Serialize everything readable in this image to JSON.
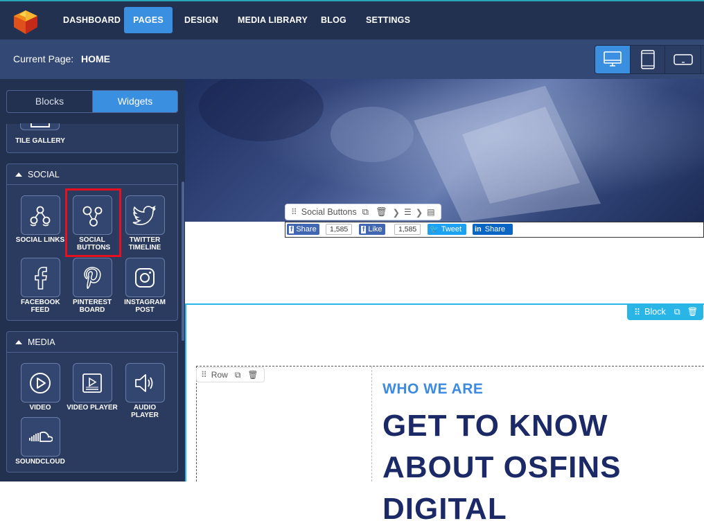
{
  "nav": {
    "items": [
      {
        "label": "DASHBOARD"
      },
      {
        "label": "PAGES"
      },
      {
        "label": "DESIGN"
      },
      {
        "label": "MEDIA LIBRARY"
      },
      {
        "label": "BLOG"
      },
      {
        "label": "SETTINGS"
      }
    ],
    "active": "PAGES"
  },
  "subbar": {
    "current_label": "Current Page:",
    "current_value": "HOME",
    "devices": [
      "desktop-icon",
      "tablet-icon",
      "mobile-landscape-icon"
    ]
  },
  "sidebar": {
    "tabs": [
      {
        "label": "Blocks"
      },
      {
        "label": "Widgets"
      }
    ],
    "active_tab": "Widgets",
    "gallery_partial": {
      "label": "TILE GALLERY"
    },
    "social": {
      "title": "SOCIAL",
      "widgets": [
        {
          "label": "SOCIAL LINKS",
          "icon": "social-links-icon"
        },
        {
          "label": "SOCIAL BUTTONS",
          "icon": "social-buttons-icon"
        },
        {
          "label": "TWITTER TIMELINE",
          "icon": "twitter-icon"
        },
        {
          "label": "FACEBOOK FEED",
          "icon": "facebook-icon"
        },
        {
          "label": "PINTEREST BOARD",
          "icon": "pinterest-icon"
        },
        {
          "label": "INSTAGRAM POST",
          "icon": "instagram-icon"
        }
      ]
    },
    "media": {
      "title": "MEDIA",
      "widgets": [
        {
          "label": "VIDEO",
          "icon": "video-icon"
        },
        {
          "label": "VIDEO PLAYER",
          "icon": "video-player-icon"
        },
        {
          "label": "AUDIO PLAYER",
          "icon": "audio-icon"
        },
        {
          "label": "SOUNDCLOUD",
          "icon": "soundcloud-icon"
        }
      ]
    }
  },
  "editor": {
    "social_toolbar": {
      "label": "Social Buttons"
    },
    "social_buttons": {
      "fb_share": "Share",
      "fb_share_count": "1,585",
      "fb_like": "Like",
      "fb_like_count": "1,585",
      "tweet": "Tweet",
      "linkedin_share": "Share"
    },
    "block_tag": {
      "label": "Block"
    },
    "row_tag": {
      "label": "Row"
    },
    "kicker": "WHO WE ARE",
    "headline": "GET TO KNOW ABOUT OSFINS DIGITAL"
  },
  "colors": {
    "topbar": "#233151",
    "subbar": "#344876",
    "accent": "#3b8fe0",
    "block_border": "#29b6e6",
    "highlight": "#e8101e",
    "headline": "#1b2a66",
    "kicker": "#3d8be0"
  }
}
